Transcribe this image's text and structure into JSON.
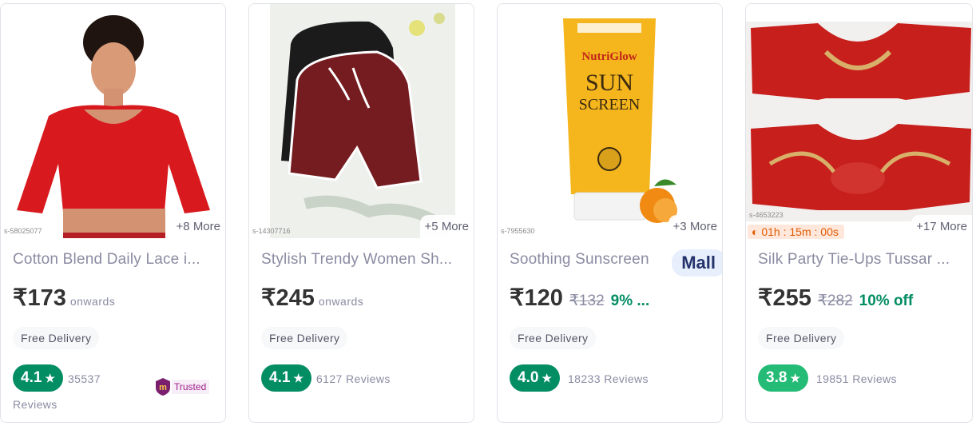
{
  "products": [
    {
      "more": "+8 More",
      "sku": "s-58025077",
      "title": "Cotton Blend Daily Lace i...",
      "price": "₹173",
      "onwards": "onwards",
      "delivery": "Free Delivery",
      "rating": "4.1",
      "reviews_count": "35537",
      "reviews_word": "Reviews",
      "badge": "Trusted",
      "rating_color": "#038d63"
    },
    {
      "more": "+5 More",
      "sku": "s-14307716",
      "title": "Stylish Trendy Women Sh...",
      "price": "₹245",
      "onwards": "onwards",
      "delivery": "Free Delivery",
      "rating": "4.1",
      "reviews": "6127 Reviews",
      "rating_color": "#038d63"
    },
    {
      "more": "+3 More",
      "sku": "s-7955630",
      "title": "Soothing Sunscreen",
      "badge": "Mall",
      "price": "₹120",
      "mrp": "₹132",
      "off": "9% ...",
      "delivery": "Free Delivery",
      "rating": "4.0",
      "reviews": "18233 Reviews",
      "rating_color": "#038d63"
    },
    {
      "more": "+17 More",
      "sku": "s-4653223",
      "timer": "01h : 15m : 00s",
      "title": "Silk Party Tie-Ups Tussar ...",
      "price": "₹255",
      "mrp": "₹282",
      "off": "10% off",
      "delivery": "Free Delivery",
      "rating": "3.8",
      "reviews": "19851 Reviews",
      "rating_color": "#23bb75"
    }
  ],
  "icons": {
    "star": "star-icon",
    "trusted": "trusted-shield-icon",
    "timer": "timer-icon"
  },
  "colors": {
    "accent_green": "#038d63",
    "light_green": "#23bb75",
    "meesho_purple": "#9f2089"
  }
}
